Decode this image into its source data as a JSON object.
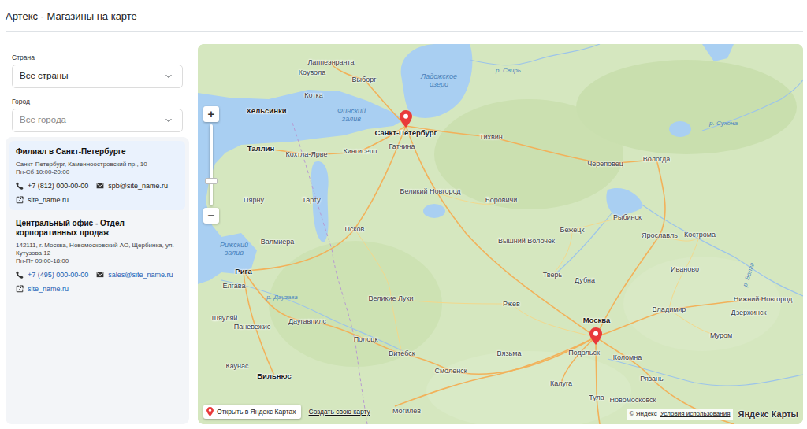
{
  "page": {
    "title": "Артекс - Магазины на карте"
  },
  "filters": [
    {
      "label": "Страна",
      "value": "Все страны",
      "disabled": false
    },
    {
      "label": "Город",
      "value": "Все города",
      "disabled": true
    }
  ],
  "stores": [
    {
      "title": "Филиал в Санкт-Петербурге",
      "address": "Санкт-Петербург, Каменноостровский пр., 10",
      "hours": "Пн-Сб 10:00-20:00",
      "phone": "+7 (812) 000-00-00",
      "email": "spb@site_name.ru",
      "site": "site_name.ru",
      "selected": true
    },
    {
      "title": "Центральный офис - Отдел корпоративных продаж",
      "address": "142111, г. Москва, Новомосковский АО, Щербинка, ул. Кутузова 12",
      "hours": "Пн-Пт 09:00-18:00",
      "phone": "+7 (495) 000-00-00",
      "email": "sales@site_name.ru",
      "site": "site_name.ru",
      "selected": false
    }
  ],
  "map": {
    "labels": [
      {
        "text": "Лаппеэнранта",
        "kind": "city"
      },
      {
        "text": "Коувола",
        "kind": "city"
      },
      {
        "text": "Котка",
        "kind": "city"
      },
      {
        "text": "Выборг",
        "kind": "city"
      },
      {
        "text": "Хельсинки",
        "kind": "capital"
      },
      {
        "text": "Санкт-Петербург",
        "kind": "capital"
      },
      {
        "text": "Ладожское озеро",
        "kind": "water"
      },
      {
        "text": "Финский залив",
        "kind": "water"
      },
      {
        "text": "р. Свирь",
        "kind": "river"
      },
      {
        "text": "Тихвин",
        "kind": "city"
      },
      {
        "text": "р. Сухона",
        "kind": "river"
      },
      {
        "text": "Таллин",
        "kind": "capital"
      },
      {
        "text": "Кохтла-Ярве",
        "kind": "city"
      },
      {
        "text": "Кингисепп",
        "kind": "city"
      },
      {
        "text": "Гатчина",
        "kind": "city"
      },
      {
        "text": "Череповец",
        "kind": "city"
      },
      {
        "text": "Вологда",
        "kind": "city"
      },
      {
        "text": "Пярну",
        "kind": "city"
      },
      {
        "text": "Тарту",
        "kind": "city"
      },
      {
        "text": "Великий Новгород",
        "kind": "city"
      },
      {
        "text": "Боровичи",
        "kind": "city"
      },
      {
        "text": "Рыбинск",
        "kind": "city"
      },
      {
        "text": "Бежецк",
        "kind": "city"
      },
      {
        "text": "Вышний Волочёк",
        "kind": "city"
      },
      {
        "text": "Ярославль",
        "kind": "city"
      },
      {
        "text": "Кострома",
        "kind": "city"
      },
      {
        "text": "Рижский залив",
        "kind": "water"
      },
      {
        "text": "Валмиера",
        "kind": "city"
      },
      {
        "text": "Псков",
        "kind": "city"
      },
      {
        "text": "Тверь",
        "kind": "city"
      },
      {
        "text": "Дубна",
        "kind": "city"
      },
      {
        "text": "Иваново",
        "kind": "city"
      },
      {
        "text": "р. Волга",
        "kind": "river"
      },
      {
        "text": "Рига",
        "kind": "capital"
      },
      {
        "text": "Нижний Новгород",
        "kind": "city"
      },
      {
        "text": "Дзержинск",
        "kind": "city"
      },
      {
        "text": "Великие Луки",
        "kind": "city"
      },
      {
        "text": "Ржев",
        "kind": "city"
      },
      {
        "text": "Владимир",
        "kind": "city"
      },
      {
        "text": "Елгава",
        "kind": "city"
      },
      {
        "text": "р. Даугава",
        "kind": "river"
      },
      {
        "text": "Шяуляй",
        "kind": "city"
      },
      {
        "text": "Паневежис",
        "kind": "city"
      },
      {
        "text": "Даугавпилс",
        "kind": "city"
      },
      {
        "text": "Москва",
        "kind": "capital"
      },
      {
        "text": "Подольск",
        "kind": "city"
      },
      {
        "text": "Полоцк",
        "kind": "city"
      },
      {
        "text": "Витебск",
        "kind": "city"
      },
      {
        "text": "Смоленск",
        "kind": "city"
      },
      {
        "text": "Вязьма",
        "kind": "city"
      },
      {
        "text": "Муром",
        "kind": "city"
      },
      {
        "text": "Коломна",
        "kind": "city"
      },
      {
        "text": "Каунас",
        "kind": "city"
      },
      {
        "text": "Вильнюс",
        "kind": "capital"
      },
      {
        "text": "Калуга",
        "kind": "city"
      },
      {
        "text": "Рязань",
        "kind": "city"
      },
      {
        "text": "Тула",
        "kind": "city"
      },
      {
        "text": "Могилёв",
        "kind": "city"
      },
      {
        "text": "Новомосковск",
        "kind": "city"
      }
    ],
    "zoom": {
      "in": "+",
      "out": "−",
      "level": 0.3
    },
    "open_button": "Открыть в Яндекс Картах",
    "create_link": "Создать свою карту",
    "copyright": "© Яндекс",
    "terms": "Условия использования",
    "logo": "Яндекс Карты"
  }
}
